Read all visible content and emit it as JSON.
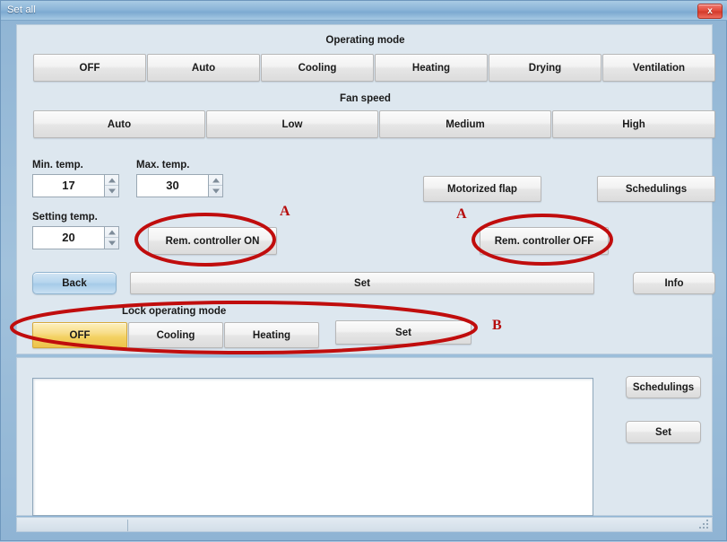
{
  "window": {
    "title": "Set all",
    "close_icon": "close-x-icon",
    "close_label": "x"
  },
  "operating_mode": {
    "heading": "Operating mode",
    "buttons": [
      {
        "label": "OFF"
      },
      {
        "label": "Auto"
      },
      {
        "label": "Cooling"
      },
      {
        "label": "Heating"
      },
      {
        "label": "Drying"
      },
      {
        "label": "Ventilation"
      }
    ]
  },
  "fan_speed": {
    "heading": "Fan speed",
    "buttons": [
      {
        "label": "Auto"
      },
      {
        "label": "Low"
      },
      {
        "label": "Medium"
      },
      {
        "label": "High"
      }
    ]
  },
  "temperature": {
    "min": {
      "label": "Min. temp.",
      "value": "17"
    },
    "max": {
      "label": "Max. temp.",
      "value": "30"
    },
    "setting": {
      "label": "Setting temp.",
      "value": "20"
    }
  },
  "controls": {
    "motorized_flap": "Motorized flap",
    "schedulings_top": "Schedulings",
    "rem_controller_on": "Rem. controller ON",
    "rem_controller_off": "Rem. controller OFF",
    "back": "Back",
    "set_main": "Set",
    "info": "Info"
  },
  "lock_operating_mode": {
    "heading": "Lock operating mode",
    "options": [
      {
        "label": "OFF",
        "selected": true
      },
      {
        "label": "Cooling",
        "selected": false
      },
      {
        "label": "Heating",
        "selected": false
      }
    ],
    "set_label": "Set"
  },
  "bottom_panel": {
    "list_items": [],
    "schedulings": "Schedulings",
    "set": "Set"
  },
  "annotations": [
    {
      "letter": "A",
      "target": "rem-controller-on"
    },
    {
      "letter": "A",
      "target": "rem-controller-off"
    },
    {
      "letter": "B",
      "target": "lock-operating-mode-group"
    }
  ],
  "colors": {
    "annotation": "#b60b0b",
    "selected_button": "#f3d163",
    "titlebar": "#8cb5d8",
    "close_button": "#e14b3c",
    "panel_background": "#dde7ef"
  }
}
